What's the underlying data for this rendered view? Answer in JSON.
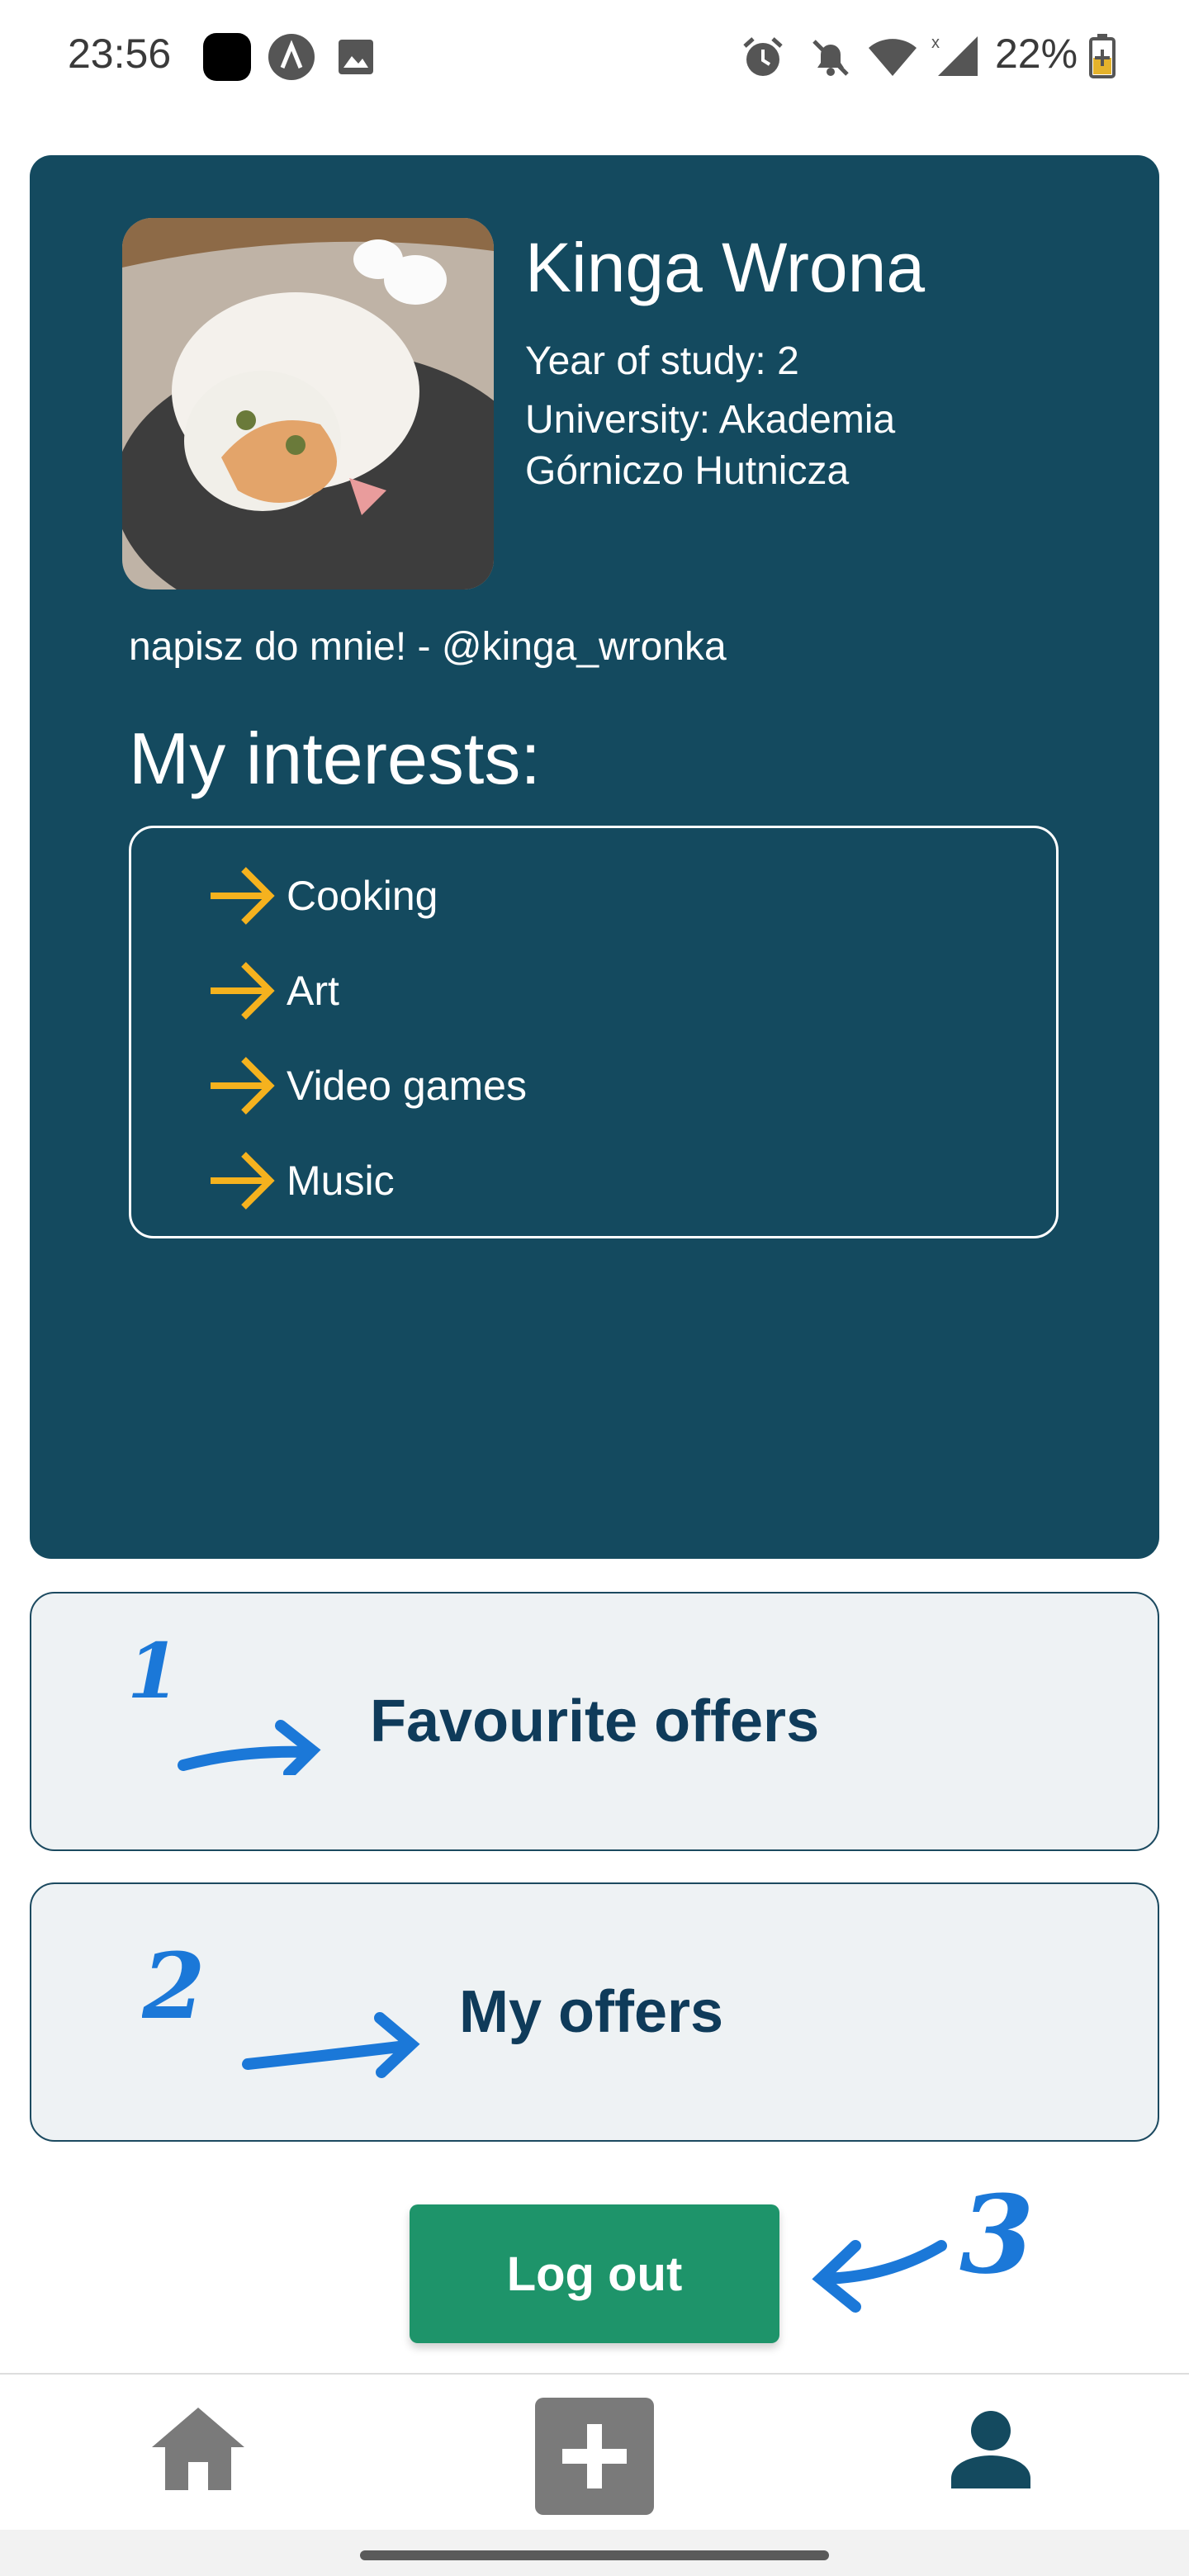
{
  "status_bar": {
    "time": "23:56",
    "battery": "22%",
    "icons": [
      "app-icon",
      "a-icon",
      "image-icon",
      "alarm-icon",
      "bell-off-icon",
      "wifi-icon",
      "signal-icon",
      "battery-charging-icon"
    ]
  },
  "profile": {
    "name": "Kinga Wrona",
    "year_of_study": "Year of study: 2",
    "university": "University: Akademia Górniczo Hutnicza",
    "bio": "napisz do mnie! - @kinga_wronka",
    "interests_title": "My interests:",
    "interests": [
      "Cooking",
      "Art",
      "Video games",
      "Music"
    ],
    "colors": {
      "card": "#144a5f",
      "arrow": "#f5b21e"
    }
  },
  "options": {
    "favourite": {
      "label": "Favourite offers",
      "annotation": "1"
    },
    "my_offers": {
      "label": "My offers",
      "annotation": "2"
    }
  },
  "logout": {
    "label": "Log out",
    "annotation": "3",
    "color": "#1e946a"
  },
  "bottom_nav": {
    "items": [
      "home-icon",
      "add-icon",
      "profile-icon"
    ],
    "active": "profile-icon"
  }
}
